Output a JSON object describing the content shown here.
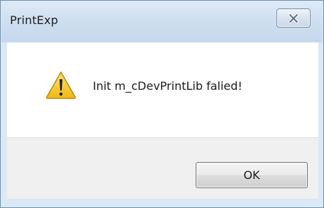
{
  "window": {
    "title": "PrintExp",
    "close_icon": "close-icon"
  },
  "message": {
    "icon": "warning-icon",
    "text": "Init m_cDevPrintLib falied!"
  },
  "buttons": {
    "ok_label": "OK"
  },
  "colors": {
    "title_bar": "#cfdff0",
    "content_bg": "#ffffff",
    "footer_bg": "#f0f0f0",
    "warning_fill": "#f5c518"
  }
}
